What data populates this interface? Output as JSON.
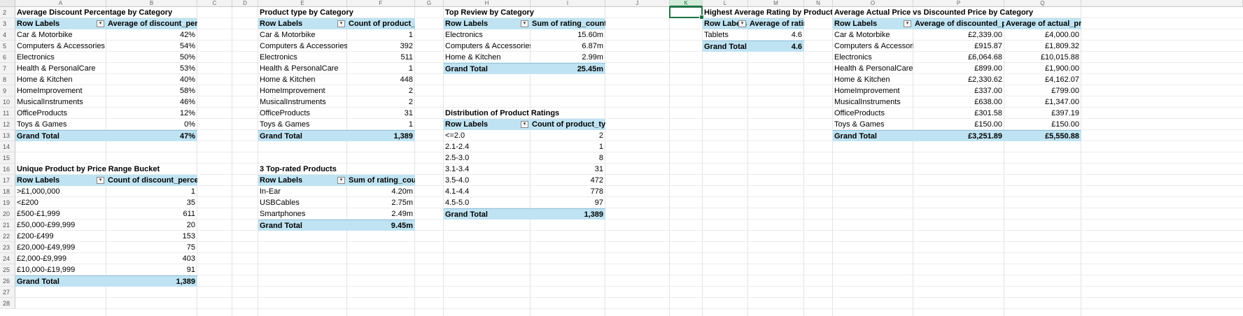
{
  "sheet": {
    "columns": [
      "A",
      "B",
      "C",
      "D",
      "E",
      "F",
      "G",
      "H",
      "I",
      "J",
      "K",
      "L",
      "M",
      "N",
      "O",
      "P",
      "Q"
    ],
    "rows": [
      "2",
      "3",
      "4",
      "5",
      "6",
      "7",
      "8",
      "9",
      "10",
      "11",
      "12",
      "13",
      "14",
      "15",
      "16",
      "17",
      "18",
      "19",
      "20",
      "21",
      "22",
      "23",
      "24",
      "25",
      "26",
      "27",
      "28"
    ],
    "selected_cell": "K2"
  },
  "pivots": {
    "avg_discount": {
      "title": "Average Discount Percentage by Category",
      "h1": "Row Labels",
      "h2": "Average of discount_percentage",
      "rows": [
        {
          "l": "Car & Motorbike",
          "v": "42%"
        },
        {
          "l": "Computers & Accessories",
          "v": "54%"
        },
        {
          "l": "Electronics",
          "v": "50%"
        },
        {
          "l": "Health & PersonalCare",
          "v": "53%"
        },
        {
          "l": "Home & Kitchen",
          "v": "40%"
        },
        {
          "l": "HomeImprovement",
          "v": "58%"
        },
        {
          "l": "MusicalInstruments",
          "v": "46%"
        },
        {
          "l": "OfficeProducts",
          "v": "12%"
        },
        {
          "l": "Toys & Games",
          "v": "0%"
        }
      ],
      "total_label": "Grand Total",
      "total_value": "47%"
    },
    "price_range": {
      "title": "Unique Product by Price Range Bucket",
      "h1": "Row Labels",
      "h2": "Count of discount_percentage",
      "rows": [
        {
          "l": ">£1,000,000",
          "v": "1"
        },
        {
          "l": "<£200",
          "v": "35"
        },
        {
          "l": "£500-£1,999",
          "v": "611"
        },
        {
          "l": "£50,000-£99,999",
          "v": "20"
        },
        {
          "l": "£200-£499",
          "v": "153"
        },
        {
          "l": "£20,000-£49,999",
          "v": "75"
        },
        {
          "l": "£2,000-£9,999",
          "v": "403"
        },
        {
          "l": "£10,000-£19,999",
          "v": "91"
        }
      ],
      "total_label": "Grand Total",
      "total_value": "1,389"
    },
    "product_type": {
      "title": "Product type by Category",
      "h1": "Row Labels",
      "h2": "Count of product_type",
      "rows": [
        {
          "l": "Car & Motorbike",
          "v": "1"
        },
        {
          "l": "Computers & Accessories",
          "v": "392"
        },
        {
          "l": "Electronics",
          "v": "511"
        },
        {
          "l": "Health & PersonalCare",
          "v": "1"
        },
        {
          "l": "Home & Kitchen",
          "v": "448"
        },
        {
          "l": "HomeImprovement",
          "v": "2"
        },
        {
          "l": "MusicalInstruments",
          "v": "2"
        },
        {
          "l": "OfficeProducts",
          "v": "31"
        },
        {
          "l": "Toys & Games",
          "v": "1"
        }
      ],
      "total_label": "Grand Total",
      "total_value": "1,389"
    },
    "top_rated": {
      "title": "3 Top-rated Products",
      "h1": "Row Labels",
      "h2": "Sum of rating_count",
      "rows": [
        {
          "l": "In-Ear",
          "v": "4.20m"
        },
        {
          "l": "USBCables",
          "v": "2.75m"
        },
        {
          "l": "Smartphones",
          "v": "2.49m"
        }
      ],
      "total_label": "Grand Total",
      "total_value": "9.45m"
    },
    "top_review": {
      "title": "Top Review by Category",
      "h1": "Row Labels",
      "h2": "Sum of rating_count",
      "rows": [
        {
          "l": "Electronics",
          "v": "15.60m"
        },
        {
          "l": "Computers & Accessories",
          "v": "6.87m"
        },
        {
          "l": "Home & Kitchen",
          "v": "2.99m"
        }
      ],
      "total_label": "Grand Total",
      "total_value": "25.45m"
    },
    "rating_dist": {
      "title": "Distribution of Product Ratings",
      "h1": "Row Labels",
      "h2": "Count of product_type",
      "rows": [
        {
          "l": "<=2.0",
          "v": "2"
        },
        {
          "l": "2.1-2.4",
          "v": "1"
        },
        {
          "l": "2.5-3.0",
          "v": "8"
        },
        {
          "l": "3.1-3.4",
          "v": "31"
        },
        {
          "l": "3.5-4.0",
          "v": "472"
        },
        {
          "l": "4.1-4.4",
          "v": "778"
        },
        {
          "l": "4.5-5.0",
          "v": "97"
        }
      ],
      "total_label": "Grand Total",
      "total_value": "1,389"
    },
    "highest_rating": {
      "title": "Highest Average Rating by Product",
      "h1": "Row Labels",
      "h2": "Average of rating",
      "rows": [
        {
          "l": "Tablets",
          "v": "4.6"
        }
      ],
      "total_label": "Grand Total",
      "total_value": "4.6"
    },
    "actual_vs_disc": {
      "title": "Average Actual Price vs Discounted Price by Category",
      "h1": "Row Labels",
      "h2": "Average of discounted_price",
      "h3": "Average of actual_price",
      "rows": [
        {
          "l": "Car & Motorbike",
          "v": "£2,339.00",
          "w": "£4,000.00"
        },
        {
          "l": "Computers & Accessories",
          "v": "£915.87",
          "w": "£1,809.32"
        },
        {
          "l": "Electronics",
          "v": "£6,064.68",
          "w": "£10,015.88"
        },
        {
          "l": "Health & PersonalCare",
          "v": "£899.00",
          "w": "£1,900.00"
        },
        {
          "l": "Home & Kitchen",
          "v": "£2,330.62",
          "w": "£4,162.07"
        },
        {
          "l": "HomeImprovement",
          "v": "£337.00",
          "w": "£799.00"
        },
        {
          "l": "MusicalInstruments",
          "v": "£638.00",
          "w": "£1,347.00"
        },
        {
          "l": "OfficeProducts",
          "v": "£301.58",
          "w": "£397.19"
        },
        {
          "l": "Toys & Games",
          "v": "£150.00",
          "w": "£150.00"
        }
      ],
      "total_label": "Grand Total",
      "total_value": "£3,251.89",
      "total_value2": "£5,550.88"
    }
  }
}
